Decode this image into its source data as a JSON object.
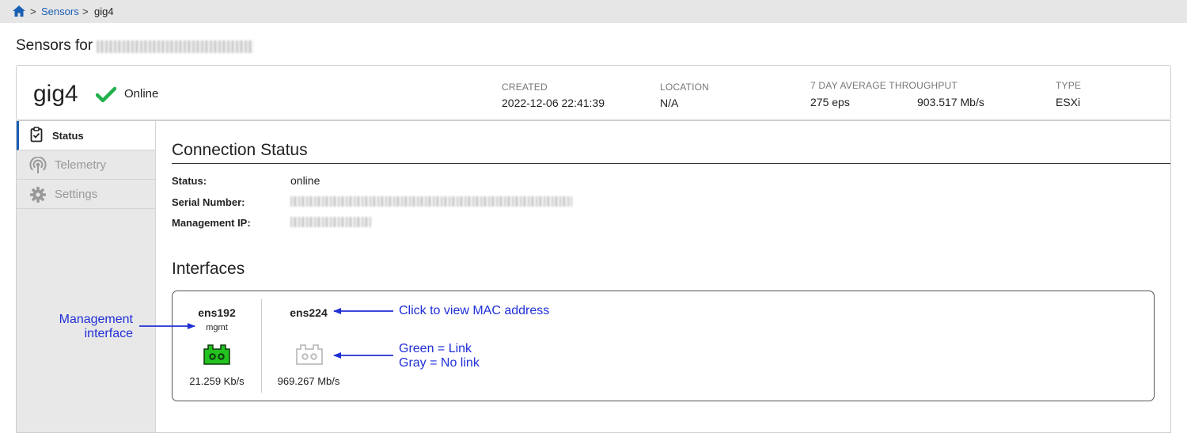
{
  "breadcrumb": {
    "home_icon": "home-icon",
    "separator": ">",
    "items": [
      "Sensors",
      "gig4"
    ]
  },
  "page": {
    "title_prefix": "Sensors for"
  },
  "sensor": {
    "name": "gig4",
    "status": "Online",
    "status_color": "#22b14c",
    "created_label": "CREATED",
    "created_value": "2022-12-06 22:41:39",
    "location_label": "LOCATION",
    "location_value": "N/A",
    "throughput_label": "7 DAY AVERAGE THROUGHPUT",
    "throughput_eps": "275 eps",
    "throughput_rate": "903.517 Mb/s",
    "type_label": "TYPE",
    "type_value": "ESXi"
  },
  "sidebar": {
    "items": [
      {
        "label": "Status",
        "icon": "clipboard-check-icon",
        "active": true
      },
      {
        "label": "Telemetry",
        "icon": "broadcast-icon",
        "active": false
      },
      {
        "label": "Settings",
        "icon": "gear-icon",
        "active": false
      }
    ]
  },
  "connection": {
    "title": "Connection Status",
    "status_label": "Status:",
    "status_value": "online",
    "serial_label": "Serial Number:",
    "mgmt_ip_label": "Management IP:"
  },
  "interfaces": {
    "title": "Interfaces",
    "items": [
      {
        "name": "ens192",
        "role": "mgmt",
        "speed": "21.259 Kb/s",
        "link": true,
        "link_color": "#22c21f"
      },
      {
        "name": "ens224",
        "role": "",
        "speed": "969.267 Mb/s",
        "link": false,
        "link_color": "#bdbdbd"
      }
    ]
  },
  "annotations": {
    "mgmt_line1": "Management",
    "mgmt_line2": "interface",
    "mac": "Click to view MAC address",
    "link_line1": "Green = Link",
    "link_line2": "Gray = No link",
    "color": "#1f2fd6"
  }
}
